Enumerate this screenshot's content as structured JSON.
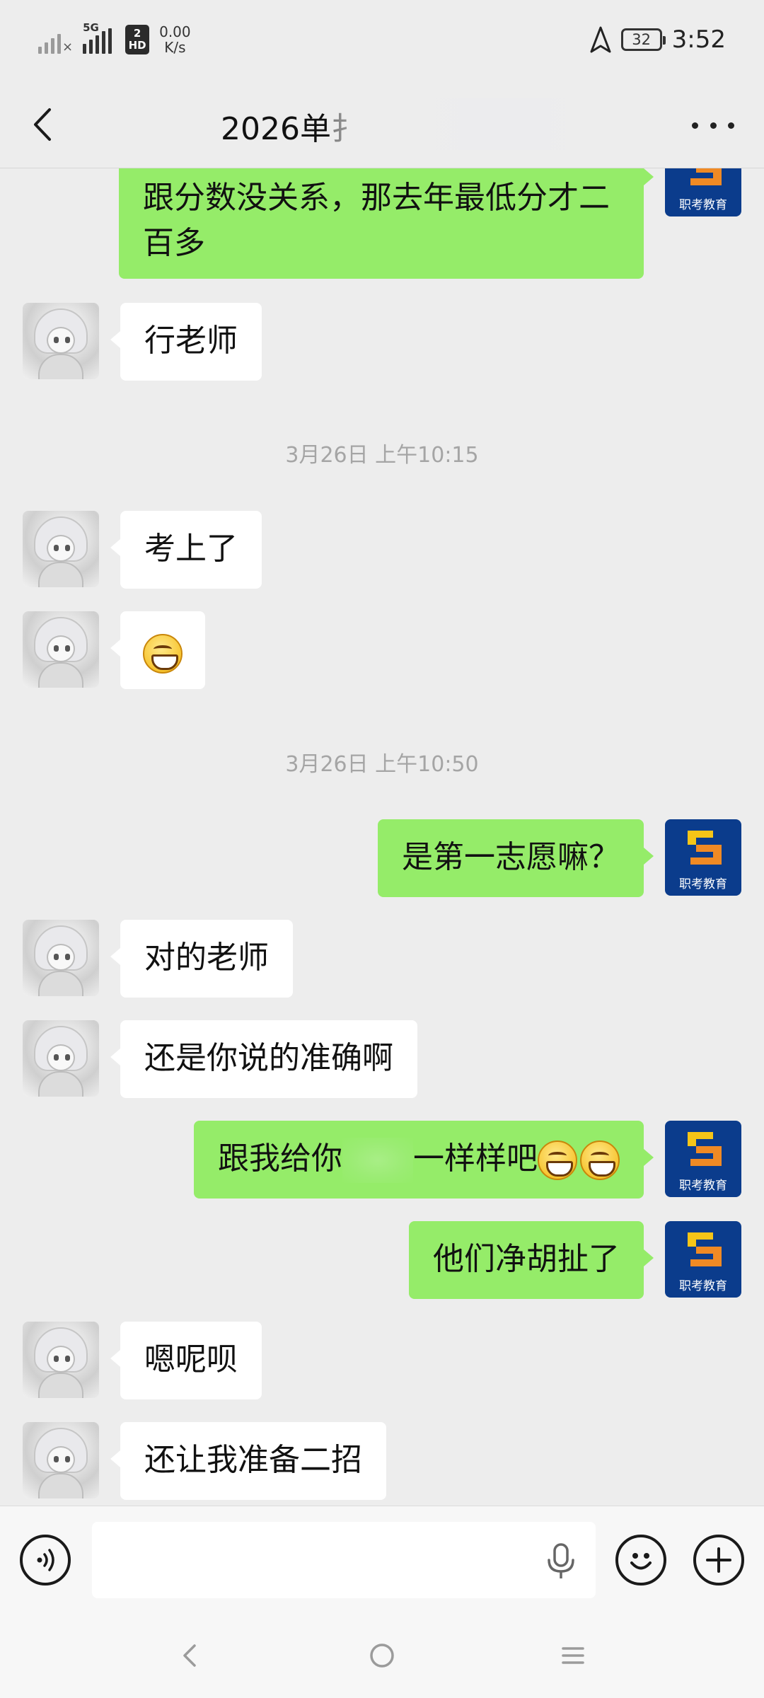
{
  "status_bar": {
    "network_type": "5G",
    "hd_badge_top": "2",
    "hd_badge_bottom": "HD",
    "net_speed_value": "0.00",
    "net_speed_unit": "K/s",
    "battery": "32",
    "time": "3:52"
  },
  "header": {
    "title": "2026单扌"
  },
  "messages": [
    {
      "side": "right",
      "text": "跟分数没关系，那去年最低分才二百多",
      "avatar_text": "职考教育"
    },
    {
      "side": "left",
      "text": "行老师"
    },
    {
      "type": "timestamp",
      "text": "3月26日 上午10:15"
    },
    {
      "side": "left",
      "text": "考上了"
    },
    {
      "side": "left",
      "text": "",
      "emoji": "grin-emoji"
    },
    {
      "type": "timestamp",
      "text": "3月26日 上午10:50"
    },
    {
      "side": "right",
      "text": "是第一志愿嘛？",
      "avatar_text": "职考教育"
    },
    {
      "side": "left",
      "text": "对的老师"
    },
    {
      "side": "left",
      "text": "还是你说的准确啊"
    },
    {
      "side": "right",
      "text_before": "跟我给你",
      "text_after": "一样样吧",
      "avatar_text": "职考教育"
    },
    {
      "side": "right",
      "text": "他们净胡扯了",
      "avatar_text": "职考教育"
    },
    {
      "side": "left",
      "text": "嗯呢呗"
    },
    {
      "side": "left",
      "text": "还让我准备二招"
    }
  ],
  "input_bar": {
    "placeholder": ""
  },
  "colors": {
    "sent_bubble": "#95ec69",
    "received_bubble": "#ffffff",
    "background": "#ededed",
    "brand_avatar": "#0b3c8c",
    "logo_yellow": "#f5c518",
    "logo_orange": "#f08a24"
  },
  "icons": {
    "back": "chevron-left-icon",
    "more": "more-dots-icon",
    "voice": "voice-icon",
    "mic": "microphone-icon",
    "emoji": "smiley-icon",
    "plus": "plus-icon",
    "nav_back": "nav-back-icon",
    "nav_home": "nav-home-icon",
    "nav_recent": "nav-menu-icon"
  }
}
